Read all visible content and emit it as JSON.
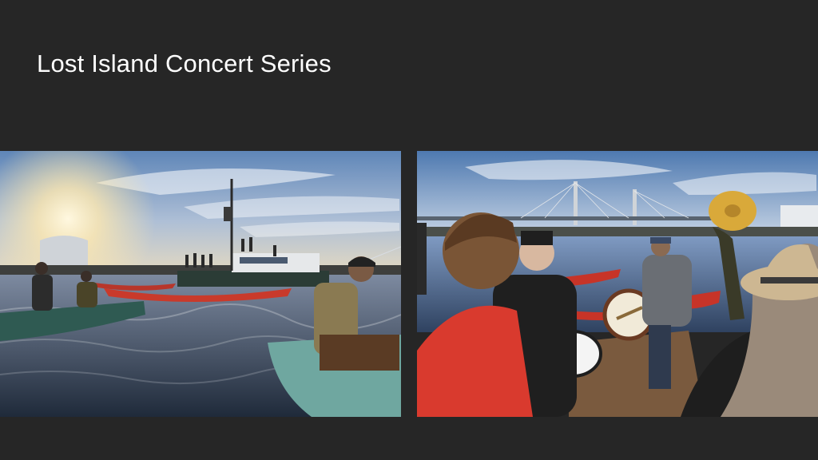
{
  "slide": {
    "title": "Lost Island Concert Series"
  },
  "photos": [
    {
      "subject": "canoes-and-tugboat-at-sunset"
    },
    {
      "subject": "marching-band-on-dock-with-bridge"
    }
  ]
}
